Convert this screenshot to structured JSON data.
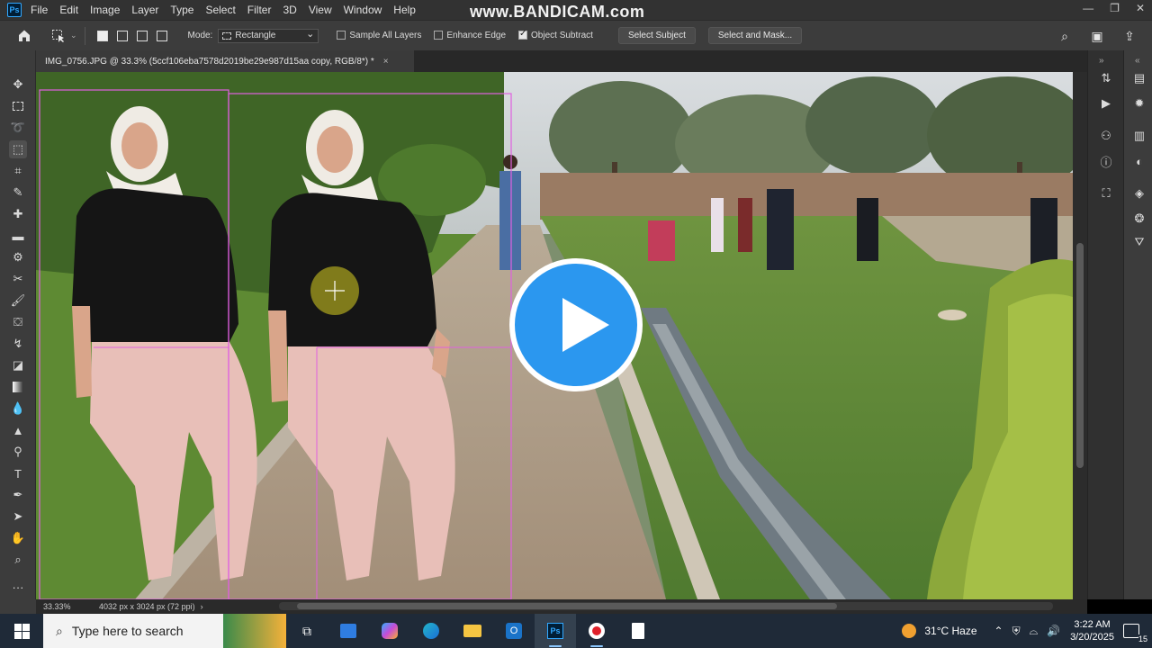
{
  "menubar": {
    "logo": "Ps",
    "items": [
      "File",
      "Edit",
      "Image",
      "Layer",
      "Type",
      "Select",
      "Filter",
      "3D",
      "View",
      "Window",
      "Help"
    ],
    "watermark": "www.BANDICAM.com"
  },
  "options": {
    "mode_label": "Mode:",
    "mode_value": "Rectangle",
    "sample_all_layers": "Sample All Layers",
    "enhance_edge": "Enhance Edge",
    "object_subtract": "Object Subtract",
    "object_subtract_checked": true,
    "select_subject": "Select Subject",
    "select_and_mask": "Select and Mask..."
  },
  "document": {
    "tab_title": "IMG_0756.JPG @ 33.3% (5ccf106eba7578d2019be29e987d15aa copy, RGB/8*) *",
    "close": "×"
  },
  "status": {
    "zoom": "33.33%",
    "info": "4032 px x 3024 px (72 ppi)",
    "arrow": "›"
  },
  "taskbar": {
    "search_placeholder": "Type here to search",
    "weather": "31°C  Haze",
    "time": "3:22 AM",
    "date": "3/20/2025",
    "notification_count": "15"
  },
  "colors": {
    "selection": "#e060e0",
    "play_blue": "#2b97ef",
    "ui_dark": "#3c3c3c"
  }
}
